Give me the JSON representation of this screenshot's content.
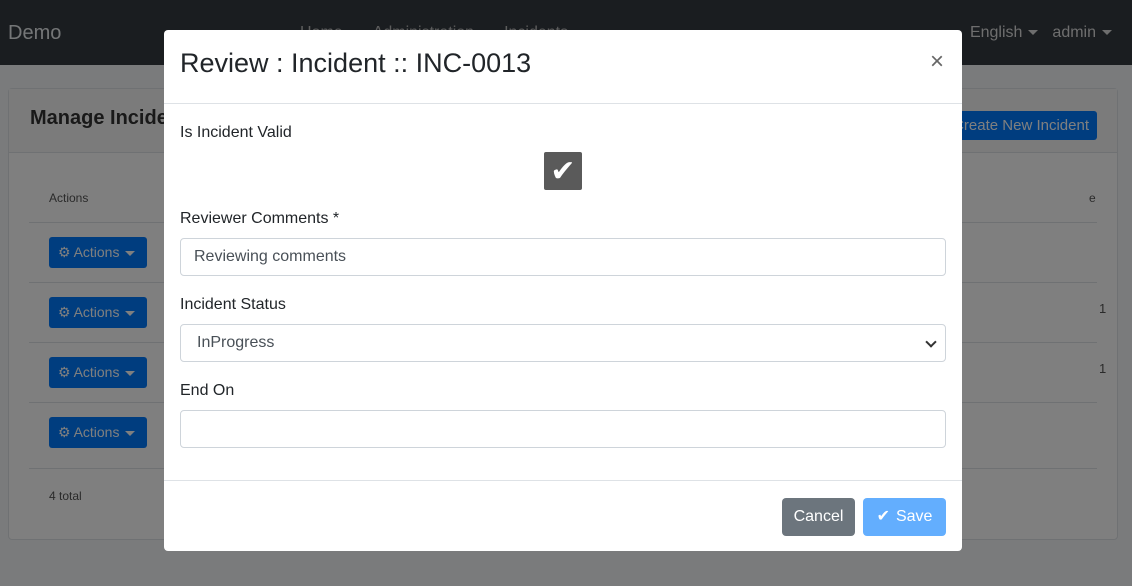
{
  "navbar": {
    "brand": "Demo",
    "links": [
      "Home",
      "Administration",
      "Incidents"
    ],
    "language": "English",
    "user": "admin"
  },
  "page": {
    "card_title": "Manage Incidents",
    "create_button": "Create New Incident",
    "actions_header": "Actions",
    "action_label": "Actions",
    "total": "4 total",
    "right_header_fragment": "e",
    "row_fragments": [
      "1",
      "1"
    ]
  },
  "modal": {
    "title": "Review : Incident :: INC-0013",
    "close": "×",
    "valid_label": "Is Incident Valid",
    "valid_checked": true,
    "comments_label": "Reviewer Comments *",
    "comments_value": "Reviewing comments",
    "status_label": "Incident Status",
    "status_value": "InProgress",
    "end_on_label": "End On",
    "end_on_value": "",
    "cancel_label": "Cancel",
    "save_label": "Save"
  },
  "colors": {
    "primary": "#007bff",
    "save_disabled": "#63aefe",
    "secondary": "#6c757d",
    "navbar": "#343a40"
  }
}
